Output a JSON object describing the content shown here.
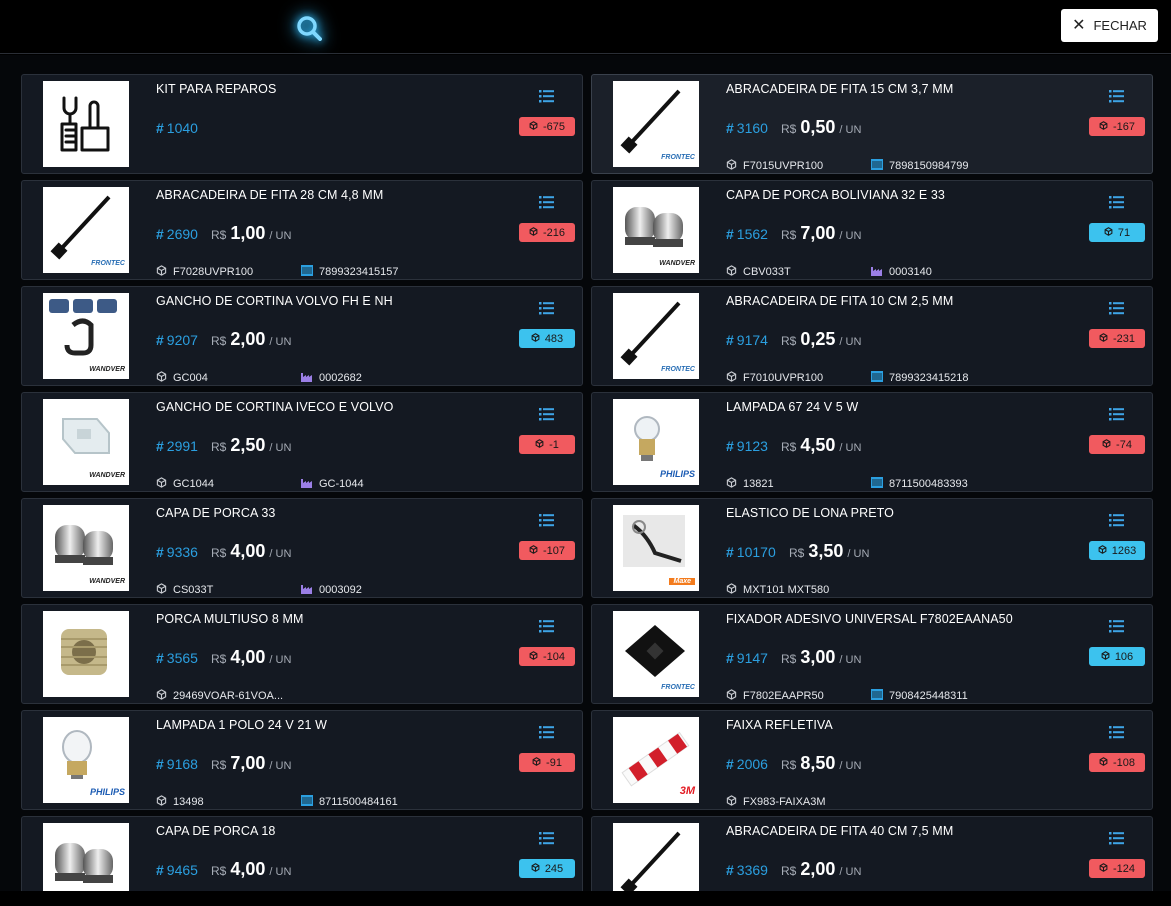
{
  "header": {
    "close_label": "FECHAR"
  },
  "currency": "R$",
  "unit": "/ UN",
  "colors": {
    "accent": "#2b9fe0",
    "badge_negative": "#f15a5f",
    "badge_positive": "#3cc2ee",
    "card_bg": "#141922"
  },
  "products": [
    {
      "name": "KIT PARA REPAROS",
      "code": "1040",
      "price": "",
      "ref": "",
      "ref_icon": "",
      "barcode": "",
      "barcode_icon": "",
      "stock": "-675",
      "image": "repair-kit-icon",
      "brand": ""
    },
    {
      "name": "ABRACADEIRA DE FITA 15 CM 3,7 MM",
      "code": "3160",
      "price": "0,50",
      "ref": "F7015UVPR100",
      "ref_icon": "box-icon",
      "barcode": "7898150984799",
      "barcode_icon": "barcode-icon",
      "stock": "-167",
      "image": "cable-tie",
      "brand": "FRONTEC"
    },
    {
      "name": "ABRACADEIRA DE FITA 28 CM 4,8 MM",
      "code": "2690",
      "price": "1,00",
      "ref": "F7028UVPR100",
      "ref_icon": "box-icon",
      "barcode": "7899323415157",
      "barcode_icon": "barcode-icon",
      "stock": "-216",
      "image": "cable-tie",
      "brand": "FRONTEC"
    },
    {
      "name": "CAPA DE PORCA BOLIVIANA 32 E 33",
      "code": "1562",
      "price": "7,00",
      "ref": "CBV033T",
      "ref_icon": "box-icon",
      "barcode": "0003140",
      "barcode_icon": "factory-icon",
      "stock": "71",
      "image": "nut-cap",
      "brand": "WANDVER"
    },
    {
      "name": "GANCHO DE CORTINA VOLVO FH E NH",
      "code": "9207",
      "price": "2,00",
      "ref": "GC004",
      "ref_icon": "box-icon",
      "barcode": "0002682",
      "barcode_icon": "factory-icon",
      "stock": "483",
      "image": "hook",
      "brand": "WANDVER"
    },
    {
      "name": "ABRACADEIRA DE FITA 10 CM 2,5 MM",
      "code": "9174",
      "price": "0,25",
      "ref": "F7010UVPR100",
      "ref_icon": "box-icon",
      "barcode": "7899323415218",
      "barcode_icon": "barcode-icon",
      "stock": "-231",
      "image": "cable-tie",
      "brand": "FRONTEC"
    },
    {
      "name": "GANCHO DE CORTINA IVECO E VOLVO",
      "code": "2991",
      "price": "2,50",
      "ref": "GC1044",
      "ref_icon": "box-icon",
      "barcode": "GC-1044",
      "barcode_icon": "factory-icon",
      "stock": "-1",
      "image": "clip",
      "brand": "WANDVER"
    },
    {
      "name": "LAMPADA 67 24 V 5 W",
      "code": "9123",
      "price": "4,50",
      "ref": "13821",
      "ref_icon": "box-icon",
      "barcode": "8711500483393",
      "barcode_icon": "barcode-icon",
      "stock": "-74",
      "image": "bulb-small",
      "brand": "PHILIPS"
    },
    {
      "name": "CAPA DE PORCA 33",
      "code": "9336",
      "price": "4,00",
      "ref": "CS033T",
      "ref_icon": "box-icon",
      "barcode": "0003092",
      "barcode_icon": "factory-icon",
      "stock": "-107",
      "image": "nut-cap",
      "brand": "WANDVER"
    },
    {
      "name": "ELASTICO DE LONA PRETO",
      "code": "10170",
      "price": "3,50",
      "ref": "MXT101 MXT580",
      "ref_icon": "box-icon",
      "barcode": "",
      "barcode_icon": "",
      "stock": "1263",
      "image": "elastic",
      "brand": "Maxe"
    },
    {
      "name": "PORCA MULTIUSO 8 MM",
      "code": "3565",
      "price": "4,00",
      "ref": "29469VOAR-61VOA...",
      "ref_icon": "box-icon",
      "barcode": "",
      "barcode_icon": "",
      "stock": "-104",
      "image": "insert-nut",
      "brand": ""
    },
    {
      "name": "FIXADOR ADESIVO UNIVERSAL F7802EAANA50",
      "code": "9147",
      "price": "3,00",
      "ref": "F7802EAAPR50",
      "ref_icon": "box-icon",
      "barcode": "7908425448311",
      "barcode_icon": "barcode-icon",
      "stock": "106",
      "image": "adhesive-mount",
      "brand": "FRONTEC"
    },
    {
      "name": "LAMPADA 1 POLO 24 V 21 W",
      "code": "9168",
      "price": "7,00",
      "ref": "13498",
      "ref_icon": "box-icon",
      "barcode": "8711500484161",
      "barcode_icon": "barcode-icon",
      "stock": "-91",
      "image": "bulb-large",
      "brand": "PHILIPS"
    },
    {
      "name": "FAIXA REFLETIVA",
      "code": "2006",
      "price": "8,50",
      "ref": "FX983-FAIXA3M",
      "ref_icon": "box-icon",
      "barcode": "",
      "barcode_icon": "",
      "stock": "-108",
      "image": "reflective-tape",
      "brand": "3M"
    },
    {
      "name": "CAPA DE PORCA 18",
      "code": "9465",
      "price": "4,00",
      "ref": "",
      "ref_icon": "",
      "barcode": "",
      "barcode_icon": "",
      "stock": "245",
      "image": "nut-cap",
      "brand": ""
    },
    {
      "name": "ABRACADEIRA DE FITA 40 CM 7,5 MM",
      "code": "3369",
      "price": "2,00",
      "ref": "",
      "ref_icon": "",
      "barcode": "",
      "barcode_icon": "",
      "stock": "-124",
      "image": "cable-tie",
      "brand": ""
    }
  ]
}
